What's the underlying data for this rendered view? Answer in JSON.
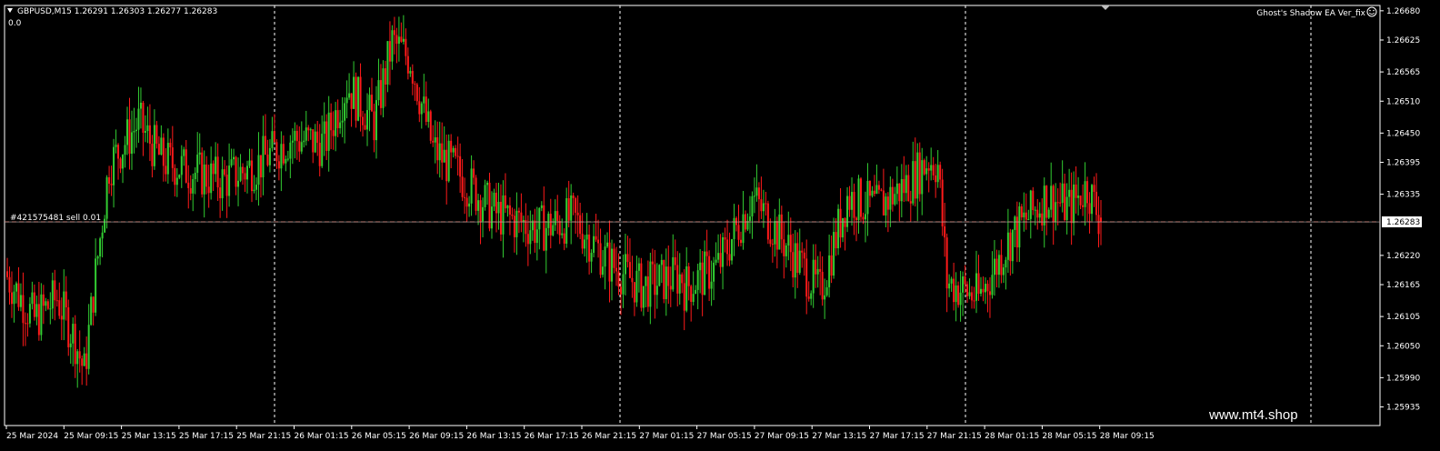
{
  "header": {
    "symbol_line": "GBPUSD,M15  1.26291 1.26303 1.26277 1.26283",
    "indicator_value": "0.0",
    "ea_label": "Ghost's Shadow EA Ver_fix",
    "order_label": "#421575481 sell 0.01",
    "watermark": "www.mt4.shop"
  },
  "colors": {
    "background": "#000000",
    "bull": "#32cd32",
    "bear": "#ff1a1a",
    "grid": "#ffffff",
    "order_line": "#d9473a",
    "price_tag_bg": "#ffffff",
    "price_tag_text": "#000000"
  },
  "chart_data": {
    "type": "candlestick",
    "symbol": "GBPUSD",
    "timeframe": "M15",
    "current": {
      "open": 1.26291,
      "high": 1.26303,
      "low": 1.26277,
      "close": 1.26283
    },
    "order_price": 1.26283,
    "current_price_label": "1.26283",
    "ylim": [
      1.259,
      1.2669
    ],
    "y_ticks": [
      "1.26680",
      "1.26625",
      "1.26565",
      "1.26510",
      "1.26450",
      "1.26395",
      "1.26335",
      "1.26220",
      "1.26165",
      "1.26105",
      "1.26050",
      "1.25990",
      "1.25935"
    ],
    "x_ticks": [
      "25 Mar 2024",
      "25 Mar 09:15",
      "25 Mar 13:15",
      "25 Mar 17:15",
      "25 Mar 21:15",
      "26 Mar 01:15",
      "26 Mar 05:15",
      "26 Mar 09:15",
      "26 Mar 13:15",
      "26 Mar 17:15",
      "26 Mar 21:15",
      "27 Mar 01:15",
      "27 Mar 05:15",
      "27 Mar 09:15",
      "27 Mar 13:15",
      "27 Mar 17:15",
      "27 Mar 21:15",
      "28 Mar 01:15",
      "28 Mar 05:15",
      "28 Mar 09:15"
    ],
    "candle_count": 300,
    "close_anchors": [
      [
        0,
        1.2618
      ],
      [
        12,
        1.261
      ],
      [
        22,
        1.2614
      ],
      [
        30,
        1.2606
      ],
      [
        34,
        1.26
      ],
      [
        38,
        1.2615
      ],
      [
        45,
        1.2639
      ],
      [
        58,
        1.2647
      ],
      [
        68,
        1.264
      ],
      [
        80,
        1.2638
      ],
      [
        95,
        1.2636
      ],
      [
        110,
        1.2639
      ],
      [
        125,
        1.2644
      ],
      [
        140,
        1.2643
      ],
      [
        150,
        1.2654
      ],
      [
        162,
        1.2647
      ],
      [
        170,
        1.2662
      ],
      [
        178,
        1.2659
      ],
      [
        188,
        1.2642
      ],
      [
        198,
        1.2638
      ],
      [
        215,
        1.263
      ],
      [
        235,
        1.2627
      ],
      [
        250,
        1.2629
      ],
      [
        265,
        1.2621
      ],
      [
        280,
        1.2616
      ],
      [
        295,
        1.2618
      ]
    ],
    "close_anchors_b": [
      [
        0,
        1.2616
      ],
      [
        15,
        1.262
      ],
      [
        30,
        1.2633
      ],
      [
        45,
        1.2624
      ],
      [
        60,
        1.2615
      ],
      [
        72,
        1.2633
      ],
      [
        85,
        1.2631
      ],
      [
        100,
        1.2636
      ],
      [
        108,
        1.264
      ],
      [
        112,
        1.2639
      ],
      [
        116,
        1.2617
      ],
      [
        130,
        1.2614
      ],
      [
        145,
        1.2626
      ],
      [
        160,
        1.2633
      ],
      [
        170,
        1.2631
      ],
      [
        178,
        1.2635
      ],
      [
        184,
        1.26283
      ]
    ],
    "session_separators": [
      "25 Mar 21:15",
      "26 Mar 21:15",
      "27 Mar 21:15",
      "28 Mar 21:15"
    ]
  }
}
